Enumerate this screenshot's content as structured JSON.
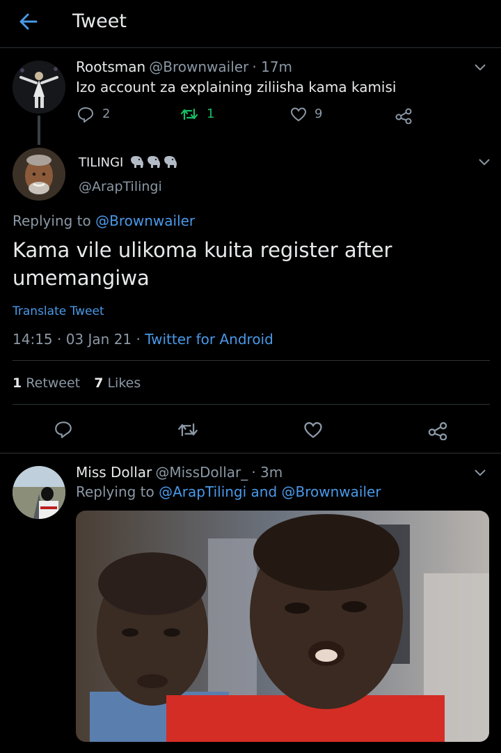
{
  "header": {
    "title": "Tweet"
  },
  "tweet1": {
    "name": "Rootsman",
    "handle": "@Brownwailer",
    "time": "· 17m",
    "text": "Izo account za explaining ziliisha kama kamisi",
    "replies": "2",
    "retweets": "1",
    "likes": "9"
  },
  "main": {
    "name": "TILINGI",
    "handle": "@ArapTilingi",
    "replying_prefix": "Replying to",
    "replying_to": "@Brownwailer",
    "text_line1": "Kama vile ulikoma kuita register after",
    "text_line2": "umemangiwa",
    "translate": "Translate Tweet",
    "time": "14:15 · 03 Jan 21 ·",
    "client": "Twitter for Android",
    "retweet_count": "1",
    "retweet_label": "Retweet",
    "like_count": "7",
    "like_label": "Likes"
  },
  "tweet3": {
    "name": "Miss Dollar",
    "handle": "@MissDollar_",
    "time": "· 3m",
    "replying_prefix": "Replying to",
    "replying_to": "@ArapTilingi and @Brownwailer"
  },
  "colors": {
    "background": "#000000",
    "accent": "#4a99e9",
    "retweet_green": "#17bf63",
    "muted": "#8b98a5"
  }
}
